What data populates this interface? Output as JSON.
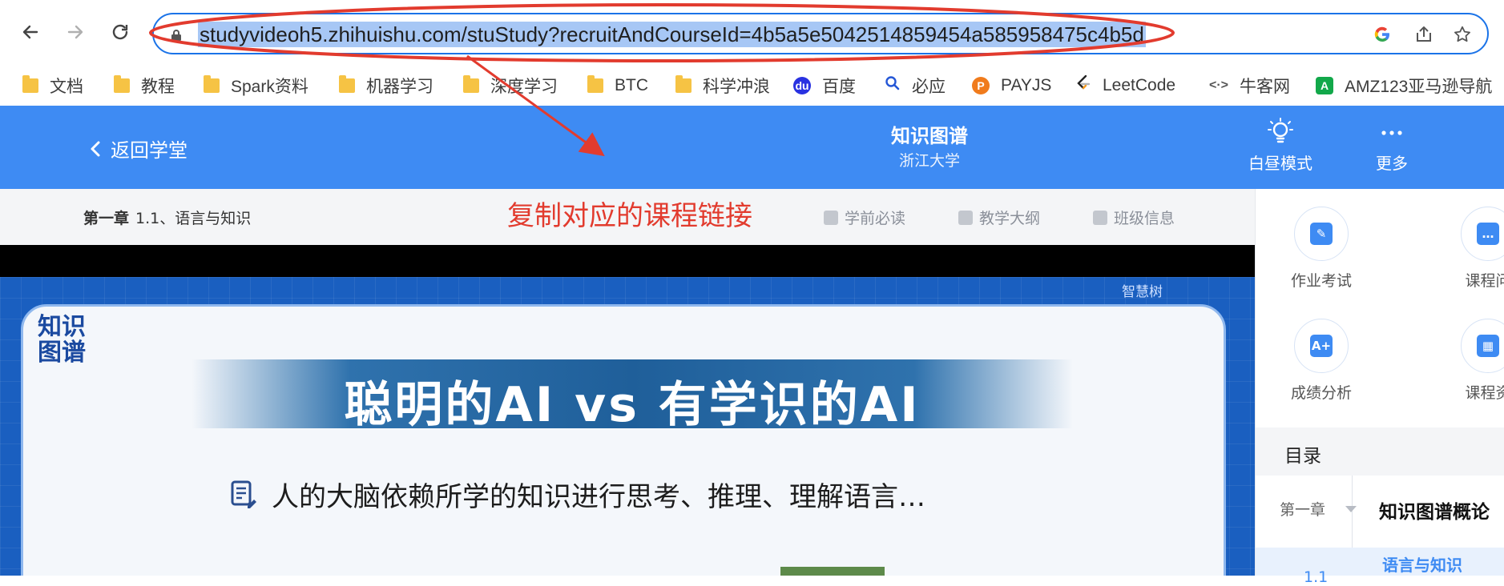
{
  "browser": {
    "url": "studyvideoh5.zhihuishu.com/stuStudy?recruitAndCourseId=4b5a5e5042514859454a585958475c4b5d",
    "back_icon": "arrow-left-icon",
    "forward_icon": "arrow-right-icon",
    "reload_icon": "reload-icon",
    "omnibox_icons": [
      "google-icon",
      "share-icon",
      "star-icon"
    ]
  },
  "bookmarks": [
    {
      "label": "文档",
      "icon": "folder-icon"
    },
    {
      "label": "教程",
      "icon": "folder-icon"
    },
    {
      "label": "Spark资料",
      "icon": "folder-icon"
    },
    {
      "label": "机器学习",
      "icon": "folder-icon"
    },
    {
      "label": "深度学习",
      "icon": "folder-icon"
    },
    {
      "label": "BTC",
      "icon": "folder-icon"
    },
    {
      "label": "科学冲浪",
      "icon": "folder-icon"
    },
    {
      "label": "百度",
      "icon": "baidu-icon"
    },
    {
      "label": "必应",
      "icon": "bing-search-icon"
    },
    {
      "label": "PAYJS",
      "icon": "payjs-icon"
    },
    {
      "label": "LeetCode",
      "icon": "leetcode-icon"
    },
    {
      "label": "牛客网",
      "icon": "nowcoder-icon"
    },
    {
      "label": "AMZ123亚马逊导航",
      "icon": "amz123-icon"
    }
  ],
  "header": {
    "back_label": "返回学堂",
    "title": "知识图谱",
    "subtitle": "浙江大学",
    "day_mode_label": "白昼模式",
    "more_label": "更多"
  },
  "chapter_bar": {
    "chapter": "第一章",
    "section": "1.1、语言与知识",
    "links": [
      "学前必读",
      "教学大纲",
      "班级信息"
    ]
  },
  "annotation": {
    "text": "复制对应的课程链接",
    "color": "#e23b2e"
  },
  "video": {
    "logo_text": "知识图谱",
    "brand": "智慧树",
    "banner": "聪明的AI vs 有学识的AI",
    "line": "人的大脑依赖所学的知识进行思考、推理、理解语言…"
  },
  "sidebar": {
    "tools": [
      {
        "label": "作业考试",
        "icon": "homework-icon"
      },
      {
        "label": "课程问",
        "icon": "chat-icon"
      },
      {
        "label": "成绩分析",
        "icon": "analysis-icon"
      },
      {
        "label": "课程资",
        "icon": "folder-icon"
      }
    ],
    "toc_title": "目录",
    "chapter_label": "第一章",
    "chapter_title": "知识图谱概论",
    "section_num": "1.1",
    "section_title": "语言与知识"
  },
  "colors": {
    "header_blue": "#3e8bf3",
    "annotation_red": "#e23b2e"
  }
}
